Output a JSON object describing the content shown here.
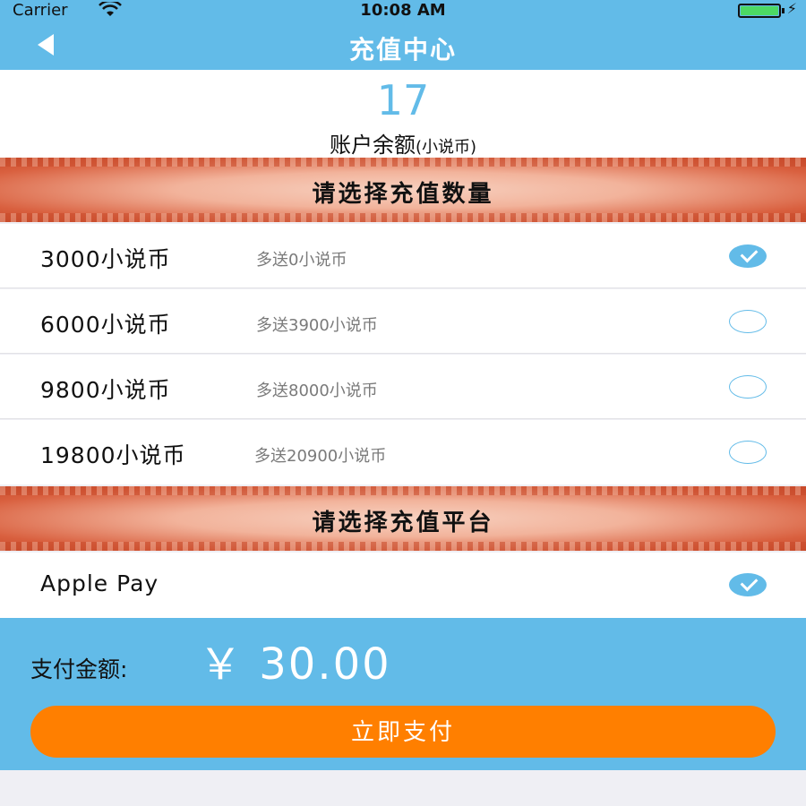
{
  "status_bar": {
    "carrier": "Carrier",
    "wifi_icon": "wifi-icon",
    "time": "10:08 AM",
    "battery_icon": "battery-icon",
    "charging_icon": "bolt-icon"
  },
  "nav": {
    "back_icon": "back-arrow-icon",
    "title": "充值中心"
  },
  "balance": {
    "amount": "17",
    "label": "账户余额",
    "unit": "(小说币)"
  },
  "quantity_section": {
    "banner_text": "请选择充值数量",
    "options": [
      {
        "name": "3000小说币",
        "bonus": "多送0小说币",
        "selected": true
      },
      {
        "name": "6000小说币",
        "bonus": "多送3900小说币",
        "selected": false
      },
      {
        "name": "9800小说币",
        "bonus": "多送8000小说币",
        "selected": false
      },
      {
        "name": "19800小说币",
        "bonus": "多送20900小说币",
        "selected": false
      }
    ]
  },
  "platform_section": {
    "banner_text": "请选择充值平台",
    "options": [
      {
        "name": "Apple Pay",
        "selected": true
      }
    ]
  },
  "payment": {
    "label": "支付金额:",
    "amount": "￥ 30.00",
    "button_label": "立即支付"
  },
  "colors": {
    "primary_blue": "#62bbe8",
    "pay_button_orange": "#ff7f00",
    "banner_red": "#c84a2a"
  }
}
